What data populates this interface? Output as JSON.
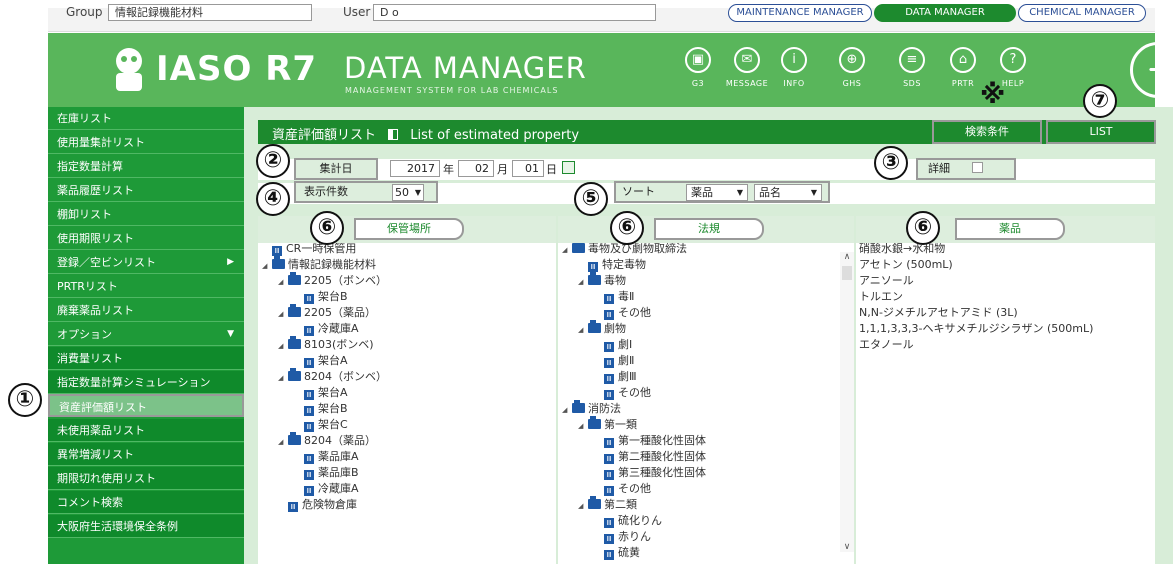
{
  "topbar": {
    "group_label": "Group",
    "group_value": "情報記録機能材料",
    "user_label": "User",
    "user_value": "D o",
    "modes": [
      "MAINTENANCE MANAGER",
      "DATA MANAGER",
      "CHEMICAL MANAGER"
    ]
  },
  "header": {
    "logo": "IASO R7",
    "title": "DATA MANAGER",
    "subtitle": "MANAGEMENT SYSTEM FOR LAB CHEMICALS",
    "icons": [
      {
        "icon": "g3-icon",
        "label": "G3"
      },
      {
        "icon": "message-icon",
        "label": "MESSAGE"
      },
      {
        "icon": "info-icon",
        "label": "INFO"
      },
      {
        "icon": "globe-icon",
        "label": "GHS"
      },
      {
        "icon": "document-icon",
        "label": "SDS"
      },
      {
        "icon": "building-icon",
        "label": "PRTR"
      },
      {
        "icon": "help-icon",
        "label": "HELP"
      }
    ]
  },
  "sidebar": {
    "items": [
      {
        "label": "在庫リスト"
      },
      {
        "label": "使用量集計リスト"
      },
      {
        "label": "指定数量計算"
      },
      {
        "label": "薬品履歴リスト"
      },
      {
        "label": "棚卸リスト"
      },
      {
        "label": "使用期限リスト"
      },
      {
        "label": "登録／空ビンリスト",
        "arrow": "▶"
      },
      {
        "label": "PRTRリスト"
      },
      {
        "label": "廃棄薬品リスト"
      },
      {
        "label": "オプション",
        "arrow": "▼"
      },
      {
        "label": "消費量リスト"
      },
      {
        "label": "指定数量計算シミュレーション"
      },
      {
        "label": "資産評価額リスト"
      },
      {
        "label": "未使用薬品リスト"
      },
      {
        "label": "異常増減リスト"
      },
      {
        "label": "期限切れ使用リスト"
      },
      {
        "label": "コメント検索"
      },
      {
        "label": "大阪府生活環境保全条例"
      }
    ]
  },
  "main": {
    "title_ja": "資産評価額リスト",
    "title_en": "List of estimated property",
    "search_button": "検索条件",
    "list_button": "LIST",
    "date_label": "集計日",
    "year": "2017",
    "year_unit": "年",
    "month": "02",
    "month_unit": "月",
    "day": "01",
    "day_unit": "日",
    "detail_label": "詳細",
    "count_label": "表示件数",
    "count_value": "50",
    "sort_label": "ソート",
    "sort1": "薬品",
    "sort2": "品名",
    "col1_button": "保管場所",
    "col2_button": "法規",
    "col3_button": "薬品"
  },
  "tree_location": [
    {
      "text": "CR一時保管用",
      "depth": 0,
      "kind": "leaf"
    },
    {
      "text": "情報記録機能材料",
      "depth": 0,
      "kind": "folder"
    },
    {
      "text": "2205（ボンベ）",
      "depth": 1,
      "kind": "folder"
    },
    {
      "text": "架台B",
      "depth": 2,
      "kind": "leaf"
    },
    {
      "text": "2205（薬品）",
      "depth": 1,
      "kind": "folder"
    },
    {
      "text": "冷蔵庫A",
      "depth": 2,
      "kind": "leaf"
    },
    {
      "text": "8103(ボンベ)",
      "depth": 1,
      "kind": "folder"
    },
    {
      "text": "架台A",
      "depth": 2,
      "kind": "leaf"
    },
    {
      "text": "8204（ボンベ）",
      "depth": 1,
      "kind": "folder"
    },
    {
      "text": "架台A",
      "depth": 2,
      "kind": "leaf"
    },
    {
      "text": "架台B",
      "depth": 2,
      "kind": "leaf"
    },
    {
      "text": "架台C",
      "depth": 2,
      "kind": "leaf"
    },
    {
      "text": "8204（薬品）",
      "depth": 1,
      "kind": "folder"
    },
    {
      "text": "薬品庫A",
      "depth": 2,
      "kind": "leaf"
    },
    {
      "text": "薬品庫B",
      "depth": 2,
      "kind": "leaf"
    },
    {
      "text": "冷蔵庫A",
      "depth": 2,
      "kind": "leaf"
    },
    {
      "text": "危険物倉庫",
      "depth": 1,
      "kind": "leaf"
    }
  ],
  "tree_law": [
    {
      "text": "毒物及び劇物取締法",
      "depth": 0,
      "kind": "folder"
    },
    {
      "text": "特定毒物",
      "depth": 1,
      "kind": "leaf"
    },
    {
      "text": "毒物",
      "depth": 1,
      "kind": "folder"
    },
    {
      "text": "毒Ⅱ",
      "depth": 2,
      "kind": "leaf"
    },
    {
      "text": "その他",
      "depth": 2,
      "kind": "leaf"
    },
    {
      "text": "劇物",
      "depth": 1,
      "kind": "folder"
    },
    {
      "text": "劇Ⅰ",
      "depth": 2,
      "kind": "leaf"
    },
    {
      "text": "劇Ⅱ",
      "depth": 2,
      "kind": "leaf"
    },
    {
      "text": "劇Ⅲ",
      "depth": 2,
      "kind": "leaf"
    },
    {
      "text": "その他",
      "depth": 2,
      "kind": "leaf"
    },
    {
      "text": "消防法",
      "depth": 0,
      "kind": "folder"
    },
    {
      "text": "第一類",
      "depth": 1,
      "kind": "folder"
    },
    {
      "text": "第一種酸化性固体",
      "depth": 2,
      "kind": "leaf"
    },
    {
      "text": "第二種酸化性固体",
      "depth": 2,
      "kind": "leaf"
    },
    {
      "text": "第三種酸化性固体",
      "depth": 2,
      "kind": "leaf"
    },
    {
      "text": "その他",
      "depth": 2,
      "kind": "leaf"
    },
    {
      "text": "第二類",
      "depth": 1,
      "kind": "folder"
    },
    {
      "text": "硫化りん",
      "depth": 2,
      "kind": "leaf"
    },
    {
      "text": "赤りん",
      "depth": 2,
      "kind": "leaf"
    },
    {
      "text": "硫黄",
      "depth": 2,
      "kind": "leaf"
    }
  ],
  "chemicals": [
    "硝酸水銀→水和物",
    "アセトン (500mL)",
    "アニソール",
    "トルエン",
    "N,N-ジメチルアセトアミド (3L)",
    "1,1,1,3,3,3-ヘキサメチルジシラザン (500mL)",
    "エタノール"
  ],
  "annotations": [
    "①",
    "②",
    "③",
    "④",
    "⑤",
    "⑥",
    "⑥",
    "⑥",
    "⑦",
    "※"
  ]
}
